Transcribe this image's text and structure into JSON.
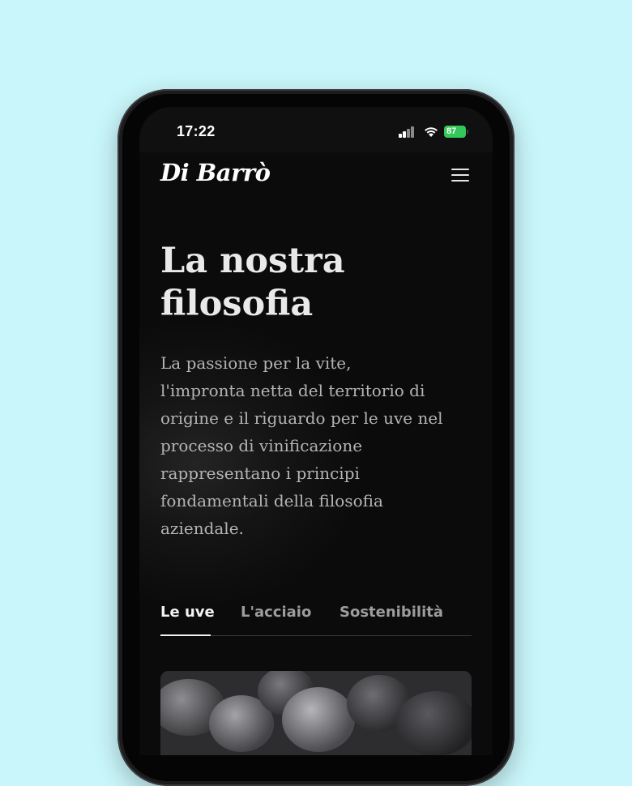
{
  "status_bar": {
    "time": "17:22",
    "battery": "87"
  },
  "header": {
    "logo": "Di Barrò",
    "menu_icon": "hamburger-menu-icon"
  },
  "hero": {
    "title": "La nostra\nfilosofia",
    "lead": "La passione per la vite,\nl'impronta netta del territorio di\norigine e il riguardo per le uve nel\nprocesso di vinificazione\nrappresentano i principi\nfondamentali della filosofia\naziendale."
  },
  "tabs": [
    {
      "label": "Le uve",
      "active": true
    },
    {
      "label": "L'acciaio",
      "active": false
    },
    {
      "label": "Sostenibilità",
      "active": false
    }
  ],
  "colors": {
    "background": "#c9f6fa",
    "screen": "#0b0b0c",
    "battery": "#34c759"
  }
}
